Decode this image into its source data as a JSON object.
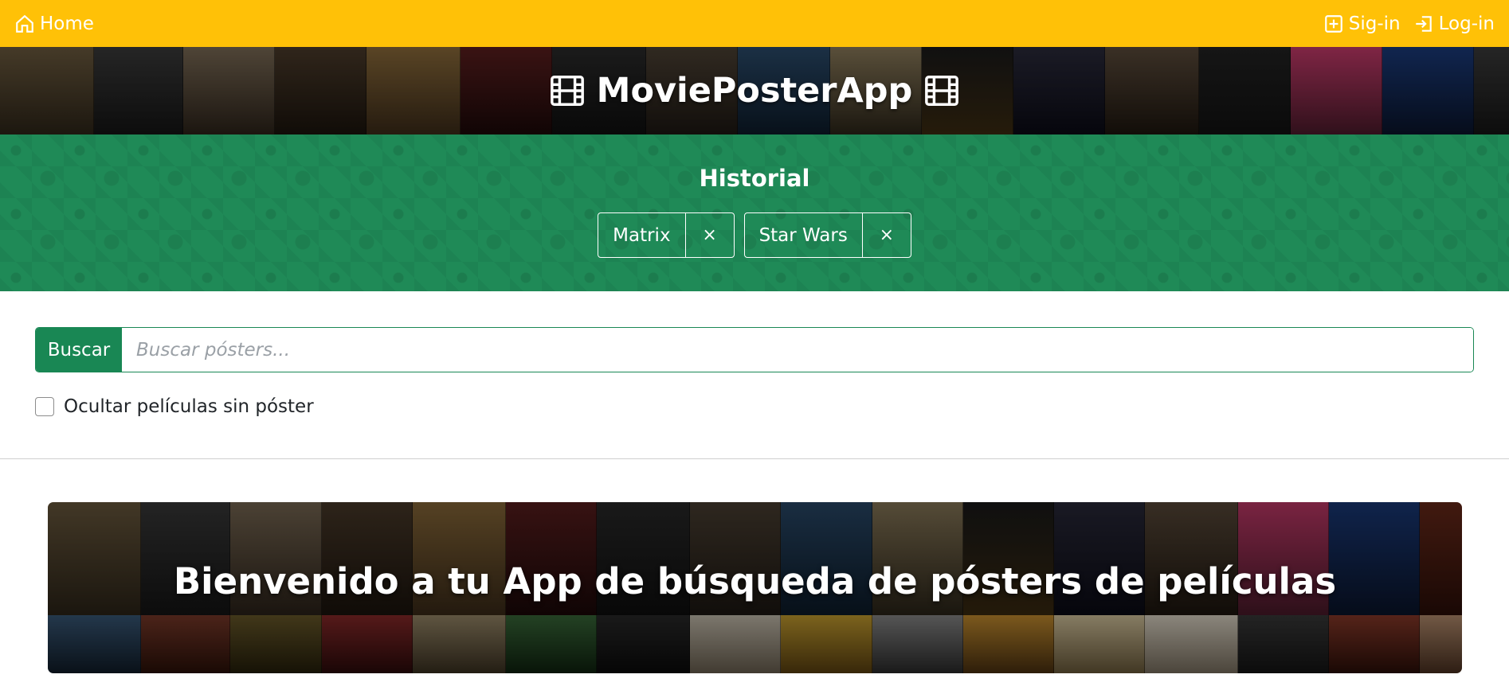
{
  "navbar": {
    "home_label": "Home",
    "signin_label": "Sig-in",
    "login_label": "Log-in"
  },
  "brand": {
    "title": "MoviePosterApp"
  },
  "history": {
    "title": "Historial",
    "items": [
      {
        "label": "Matrix",
        "close": "×"
      },
      {
        "label": "Star Wars",
        "close": "×"
      }
    ]
  },
  "search": {
    "button_label": "Buscar",
    "placeholder": "Buscar pósters...",
    "value": ""
  },
  "filter": {
    "label": "Ocultar películas sin póster",
    "checked": false
  },
  "welcome": {
    "title": "Bienvenido a tu App de búsqueda de pósters de películas"
  },
  "colors": {
    "navbar": "#ffc107",
    "history_bg": "#1f8a57",
    "primary": "#198754"
  }
}
